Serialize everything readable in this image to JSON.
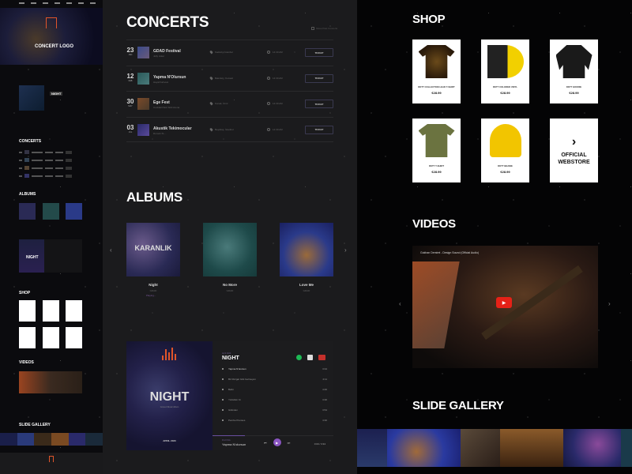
{
  "mini_page": {
    "nav": [
      "Home",
      "Concerts",
      "Albums",
      "Videos",
      "Shop",
      "Gallery",
      "Contact"
    ],
    "logo_text": "CONCERT LOGO",
    "feature_title": "NIGHT",
    "sections": [
      "CONCERTS",
      "ALBUMS",
      "SHOP",
      "VIDEOS",
      "SLIDE GALLERY"
    ],
    "player_title": "NIGHT",
    "store_label": "OFFICIAL WEBSTORE"
  },
  "concerts": {
    "title": "CONCERTS",
    "filter_label": "Show Past Concerts",
    "ticket_label": "TICKET",
    "items": [
      {
        "day": "23",
        "month": "JAN",
        "name": "GDAD Festival",
        "sub": "Jolly Joker",
        "location": "Kadıköy, İstanbul",
        "time": "14:30 AM"
      },
      {
        "day": "12",
        "month": "FEB",
        "name": "Yapma N'Olursun",
        "sub": "Hayal Kahvesi",
        "location": "Bakırköy, Kocaeli",
        "time": "14:30 AM"
      },
      {
        "day": "30",
        "month": "MAY",
        "name": "Ege Fest",
        "sub": "Cocktail Park Sirkt Arena",
        "location": "Konak, İzmir",
        "time": "14:30 AM"
      },
      {
        "day": "03",
        "month": "JUL",
        "name": "Akustik Tekimocular",
        "sub": "Dorock XL...",
        "location": "Beşiktaş, İstanbul",
        "time": "14:30 AM"
      }
    ]
  },
  "albums": {
    "title": "ALBUMS",
    "items": [
      {
        "name": "Night",
        "artist": "GDAD",
        "status": "Playing...",
        "cover_text": "KARANLIK"
      },
      {
        "name": "No More",
        "artist": "GDAD",
        "status": "",
        "cover_text": ""
      },
      {
        "name": "Love Me",
        "artist": "GDAD",
        "status": "",
        "cover_text": ""
      }
    ]
  },
  "player": {
    "cover_title": "NIGHT",
    "cover_subtitle": "Concert Music Album",
    "release_date": "APRIL 2020",
    "label": "April 2020",
    "album_title": "NIGHT",
    "tracks": [
      {
        "name": "Yapma N'olursun",
        "duration": "3:34"
      },
      {
        "name": "Bir Rüzgar Gibi Gelmeyen",
        "duration": "4:11"
      },
      {
        "name": "Belki",
        "duration": "4:40"
      },
      {
        "name": "Yürüdüm Ki",
        "duration": "3:30"
      },
      {
        "name": "Gittinden",
        "duration": "3:54"
      },
      {
        "name": "Pembe Prenses",
        "duration": "4:30"
      }
    ],
    "now_playing_label": "PLAYING",
    "now_playing_track": "Yapma N'olursun",
    "current_time": "0:00",
    "total_time": "3:34",
    "progress": 0.27
  },
  "shop": {
    "title": "SHOP",
    "items": [
      {
        "name": "DKTT COLLECTION LEAD T-SHIRT",
        "price": "€28.99"
      },
      {
        "name": "DKTT COLORED VINYL",
        "price": "€28.99"
      },
      {
        "name": "DKTT HOODIE",
        "price": "€28.99"
      },
      {
        "name": "DKTT T-SHIRT",
        "price": "€28.99"
      },
      {
        "name": "DKTT BEANIE",
        "price": "€28.99"
      }
    ],
    "store_link_label": "OFFICIAL WEBSTORE"
  },
  "videos": {
    "title": "VIDEOS",
    "caption": "Gokhan Demirel - Design Sound (Official Audio)"
  },
  "gallery": {
    "title": "SLIDE GALLERY"
  },
  "colors": {
    "accent": "#8a55c2",
    "logo": "#e0552a",
    "youtube": "#e62117",
    "spotify": "#1db954"
  }
}
